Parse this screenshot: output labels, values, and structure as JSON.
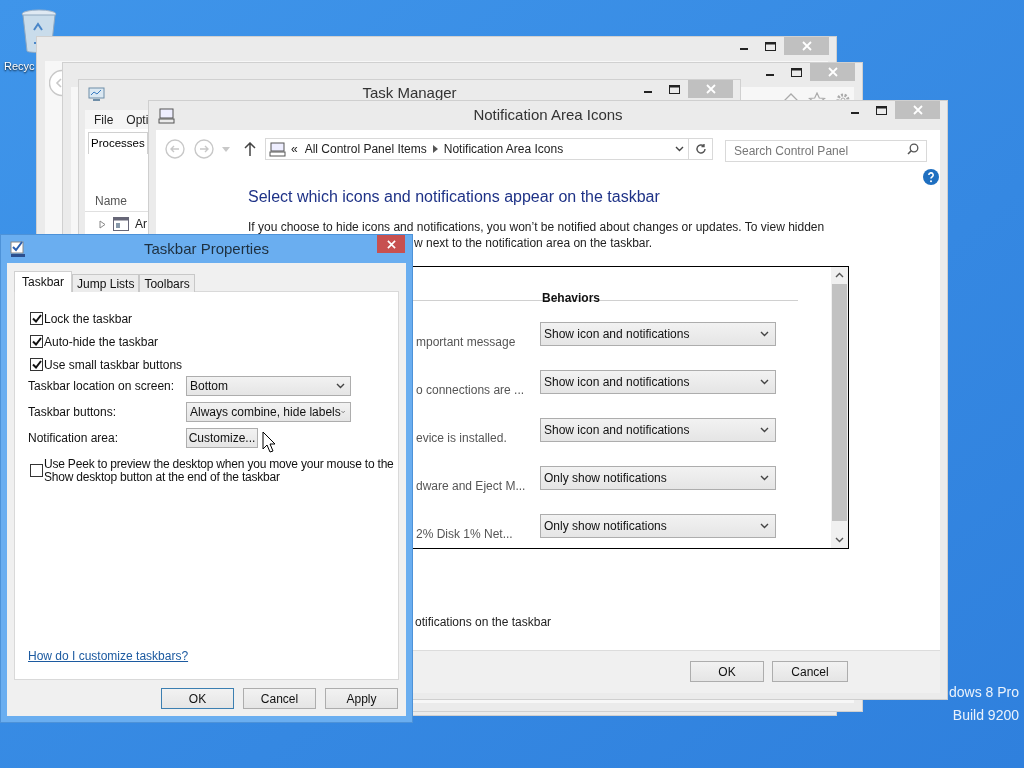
{
  "desktop": {
    "icons": [
      {
        "label": "Recyc"
      }
    ],
    "edition_lines": [
      "dows 8 Pro",
      "Build 9200"
    ]
  },
  "task_manager": {
    "title": "Task Manager",
    "menu": [
      "File",
      "Opti"
    ],
    "tabs": [
      {
        "label": "Processes",
        "selected": true
      }
    ],
    "columns": [
      "Name"
    ],
    "rows": [
      {
        "name": "Ar"
      }
    ]
  },
  "notification_window": {
    "title": "Notification Area Icons",
    "address": {
      "prefix": "«",
      "items": [
        "All Control Panel Items",
        "Notification Area Icons"
      ]
    },
    "search": {
      "placeholder": "Search Control Panel"
    },
    "heading": "Select which icons and notifications appear on the taskbar",
    "description": [
      "If you choose to hide icons and notifications, you won’t be notified about changes or updates. To view hidden",
      "w next to the notification area on the taskbar."
    ],
    "table": {
      "columns": [
        "Behaviors"
      ],
      "rows": [
        {
          "label": "mportant message",
          "behavior": "Show icon and notifications"
        },
        {
          "label": "o connections are ...",
          "behavior": "Show icon and notifications"
        },
        {
          "label": "evice is installed.",
          "behavior": "Show icon and notifications"
        },
        {
          "label": "dware and Eject M...",
          "behavior": "Only show notifications"
        },
        {
          "label": "2% Disk 1% Net...",
          "behavior": "Only show notifications"
        }
      ]
    },
    "footer_text": "otifications on the taskbar",
    "buttons": [
      {
        "label": "OK",
        "default": false
      },
      {
        "label": "Cancel",
        "default": false
      }
    ]
  },
  "taskbar_properties": {
    "title": "Taskbar Properties",
    "tabs": [
      {
        "label": "Taskbar",
        "selected": true
      },
      {
        "label": "Jump Lists",
        "selected": false
      },
      {
        "label": "Toolbars",
        "selected": false
      }
    ],
    "checkboxes": [
      {
        "label": "Lock the taskbar",
        "checked": true
      },
      {
        "label": "Auto-hide the taskbar",
        "checked": true
      },
      {
        "label": "Use small taskbar buttons",
        "checked": true
      }
    ],
    "settings": [
      {
        "label": "Taskbar location on screen:",
        "kind": "select",
        "value": "Bottom"
      },
      {
        "label": "Taskbar buttons:",
        "kind": "select",
        "value": "Always combine, hide labels"
      },
      {
        "label": "Notification area:",
        "kind": "button",
        "value": "Customize..."
      }
    ],
    "peek": {
      "label": "Use Peek to preview the desktop when you move your mouse to the Show desktop button at the end of the taskbar",
      "checked": false
    },
    "help_link": "How do I customize taskbars?",
    "buttons": [
      {
        "label": "OK",
        "default": true
      },
      {
        "label": "Cancel",
        "default": false
      },
      {
        "label": "Apply",
        "default": false
      }
    ]
  }
}
